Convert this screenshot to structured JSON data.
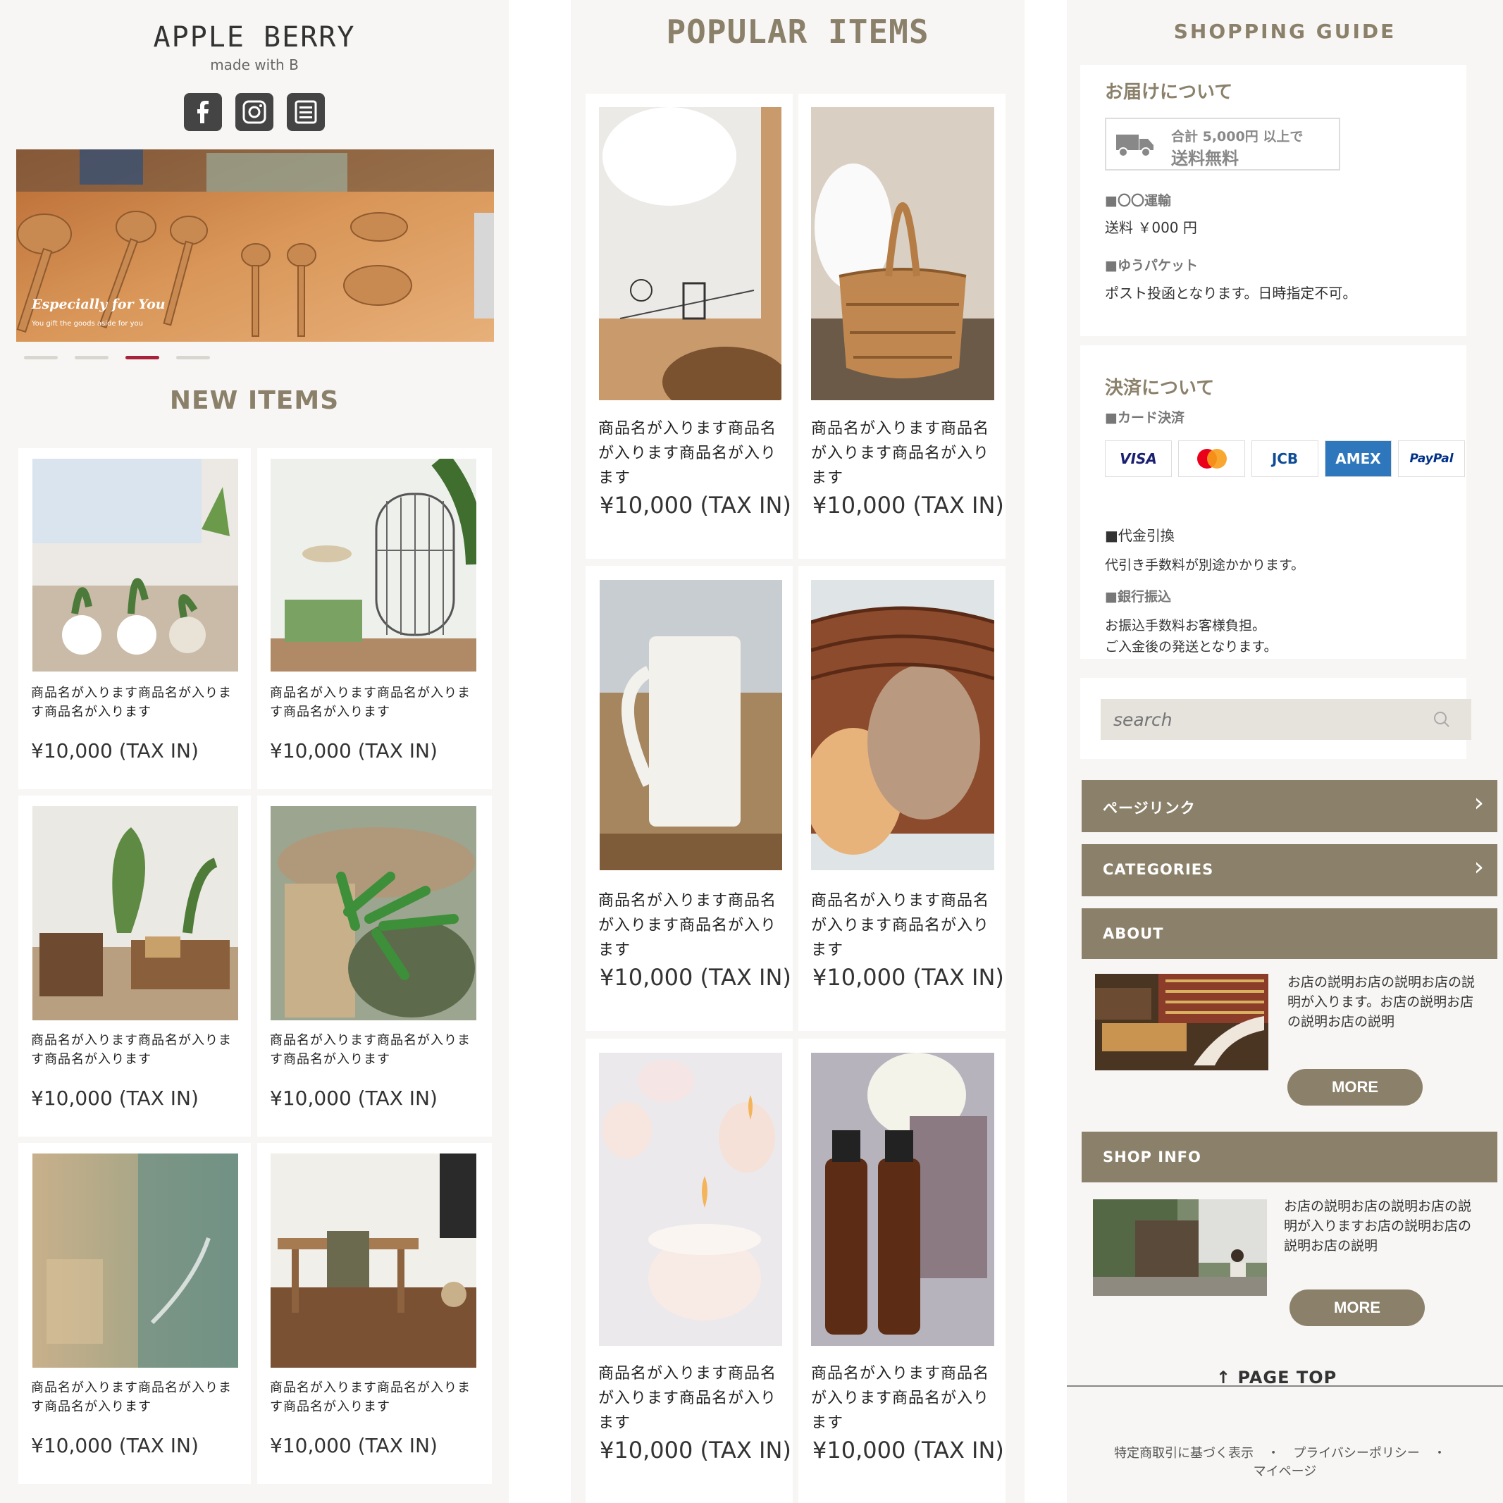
{
  "col1": {
    "brand": "APPLE BERRY",
    "brand_sub": "made with B",
    "sns": [
      "facebook-icon",
      "instagram-icon",
      "blog-icon"
    ],
    "slider": {
      "caption": "Especially for You",
      "subcaption": "You gift the goods aside for you",
      "dots": 4,
      "active_dot": 3
    },
    "section_title": "NEW ITEMS",
    "items": [
      {
        "name": "商品名が入ります商品名が入ります商品名が入ります",
        "price": "¥10,000 (TAX IN)"
      },
      {
        "name": "商品名が入ります商品名が入ります商品名が入ります",
        "price": "¥10,000 (TAX IN)"
      },
      {
        "name": "商品名が入ります商品名が入ります商品名が入ります",
        "price": "¥10,000 (TAX IN)"
      },
      {
        "name": "商品名が入ります商品名が入ります商品名が入ります",
        "price": "¥10,000 (TAX IN)"
      },
      {
        "name": "商品名が入ります商品名が入ります商品名が入ります",
        "price": "¥10,000 (TAX IN)"
      },
      {
        "name": "商品名が入ります商品名が入ります商品名が入ります",
        "price": "¥10,000 (TAX IN)"
      }
    ]
  },
  "col2": {
    "section_title": "POPULAR ITEMS",
    "items": [
      {
        "name": "商品名が入ります商品名が入ります商品名が入ります",
        "price": "¥10,000 (TAX IN)"
      },
      {
        "name": "商品名が入ります商品名が入ります商品名が入ります",
        "price": "¥10,000 (TAX IN)"
      },
      {
        "name": "商品名が入ります商品名が入ります商品名が入ります",
        "price": "¥10,000 (TAX IN)"
      },
      {
        "name": "商品名が入ります商品名が入ります商品名が入ります",
        "price": "¥10,000 (TAX IN)"
      },
      {
        "name": "商品名が入ります商品名が入ります商品名が入ります",
        "price": "¥10,000 (TAX IN)"
      },
      {
        "name": "商品名が入ります商品名が入ります商品名が入ります",
        "price": "¥10,000 (TAX IN)"
      }
    ]
  },
  "col3": {
    "section_title": "SHOPPING GUIDE",
    "delivery": {
      "title": "お届けについて",
      "free_line1": "合計 5,000円 以上で",
      "free_line2": "送料無料",
      "carrier1_label": "■〇〇運輸",
      "carrier1_text": "送料 ￥000 円",
      "carrier2_label": "■ゆうパケット",
      "carrier2_text": "ポスト投函となります。日時指定不可。"
    },
    "payment": {
      "title": "決済について",
      "card_label": "■カード決済",
      "cards": [
        "VISA",
        "MasterCard",
        "JCB",
        "AMEX",
        "PayPal"
      ],
      "cod_label": "■代金引換",
      "cod_text": "代引き手数料が別途かかります。",
      "bank_label": "■銀行振込",
      "bank_text1": "お振込手数料お客様負担。",
      "bank_text2": "ご入金後の発送となります。"
    },
    "search_placeholder": "search",
    "menu": {
      "page_link": "ページリンク",
      "categories": "CATEGORIES",
      "about": "ABOUT",
      "shop_info": "SHOP INFO"
    },
    "about_text": "お店の説明お店の説明お店の説明が入ります。お店の説明お店の説明お店の説明",
    "shop_text": "お店の説明お店の説明お店の説明が入りますお店の説明お店の説明お店の説明",
    "more": "MORE",
    "page_top": "PAGE TOP",
    "footer": {
      "link1": "特定商取引に基づく表示",
      "sep": "・",
      "link2": "プライバシーポリシー",
      "link3": "マイページ"
    }
  },
  "colors": {
    "accent": "#8b806a",
    "active_dot": "#a8223a",
    "background": "#f7f6f4"
  }
}
